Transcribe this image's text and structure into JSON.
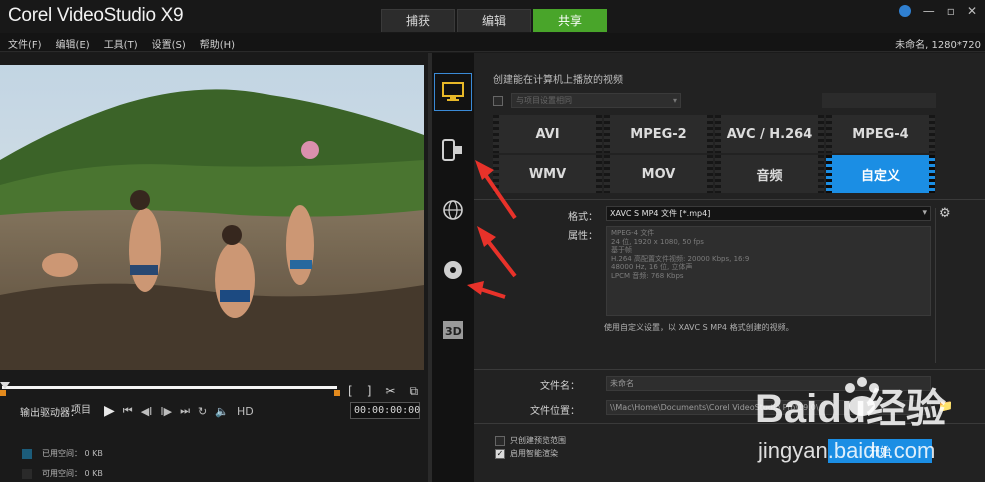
{
  "app": {
    "title": "Corel VideoStudio X9",
    "tabs": [
      "捕获",
      "编辑",
      "共享"
    ],
    "active_tab": "共享",
    "window_controls": [
      "?",
      "—",
      "▫",
      "✕"
    ]
  },
  "menu": {
    "items": [
      "文件(F)",
      "编辑(E)",
      "工具(T)",
      "设置(S)",
      "帮助(H)"
    ],
    "project_info": "未命名, 1280*720"
  },
  "player": {
    "mode_label": "项目",
    "timecode": "00:00:00:00",
    "hd_label": "HD",
    "trim_marks": [
      "[",
      "]"
    ],
    "controls": [
      "play",
      "start",
      "prev-frame",
      "next-frame",
      "end",
      "repeat",
      "volume"
    ]
  },
  "output": {
    "title": "输出驱动器：",
    "used_label": "已用空间： 0 KB",
    "free_label": "可用空间： 0 KB"
  },
  "share": {
    "description": "创建能在计算机上播放的视频",
    "preset_placeholder": "与项目设置相同",
    "formats": [
      "AVI",
      "MPEG-2",
      "AVC / H.264",
      "MPEG-4",
      "WMV",
      "MOV",
      "音频",
      "自定义"
    ],
    "selected_format": "自定义",
    "format_label": "格式：",
    "format_value": "XAVC S MP4 文件 [*.mp4]",
    "properties_label": "属性：",
    "properties": [
      "MPEG-4 文件",
      "24 位, 1920 x 1080, 50 fps",
      "基于帧",
      "H.264 高配置文件视频: 20000 Kbps, 16:9",
      "48000 Hz, 16 位, 立体声",
      "LPCM 音频: 768 Kbps"
    ],
    "properties_note": "使用自定义设置，以 XAVC S MP4 格式创建的视频。",
    "filename_label": "文件名：",
    "filename_value": "未命名",
    "location_label": "文件位置：",
    "location_value": "\\\\Mac\\Home\\Documents\\Corel VideoStudio Pro\\19.0\\",
    "option1": "只创建预览范围",
    "option2": "启用智能渲染",
    "start_label": "开始"
  },
  "watermark": {
    "brand": "Baidu经验",
    "url": "jingyan.baidu.com"
  },
  "colors": {
    "accent_green": "#49a52a",
    "accent_blue": "#1b8ee4",
    "arrow_red": "#e8322a"
  }
}
